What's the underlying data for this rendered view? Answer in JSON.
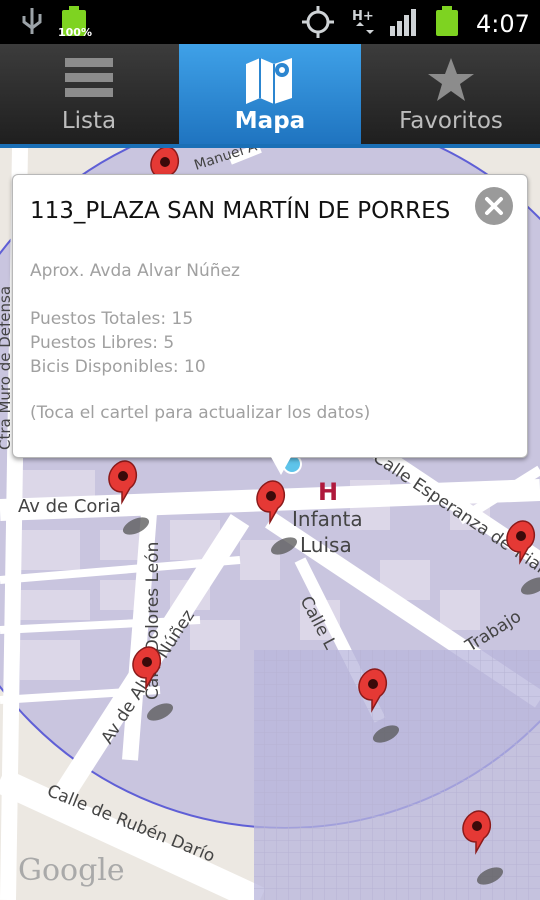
{
  "status_bar": {
    "battery_label": "100%",
    "network_label": "H+",
    "time": "4:07"
  },
  "tabs": [
    {
      "label": "Lista",
      "icon": "list-icon",
      "active": false
    },
    {
      "label": "Mapa",
      "icon": "map-icon",
      "active": true
    },
    {
      "label": "Favoritos",
      "icon": "star-icon",
      "active": false
    }
  ],
  "popup": {
    "title": "113_PLAZA SAN MARTÍN DE PORRES",
    "address": "Aprox. Avda Alvar Núñez",
    "total": "Puestos Totales: 15",
    "free": "Puestos Libres: 5",
    "bikes": "Bicis Disponibles: 10",
    "hint": "(Toca el cartel para actualizar los datos)"
  },
  "map": {
    "labels": {
      "coria": "Av de Coria",
      "dolores": "Calle Dolores León",
      "alvar": "Av de Alvar Núñez",
      "esperanza": "Calle Esperanza de Triana",
      "trabajo": "Trabajo",
      "calle_l": "Calle L",
      "ruben": "Calle de Rubén Darío",
      "muro": "Ctra Muro de Defensa",
      "manuel": "Manuel A",
      "infanta1": "Infanta",
      "infanta2": "Luisa",
      "hospital": "H",
      "google": "Google"
    },
    "colors": {
      "radius_fill": "#c9c5df",
      "radius_stroke": "#5f5fd6",
      "pin": "#e53935",
      "hospital": "#b0193c"
    }
  }
}
